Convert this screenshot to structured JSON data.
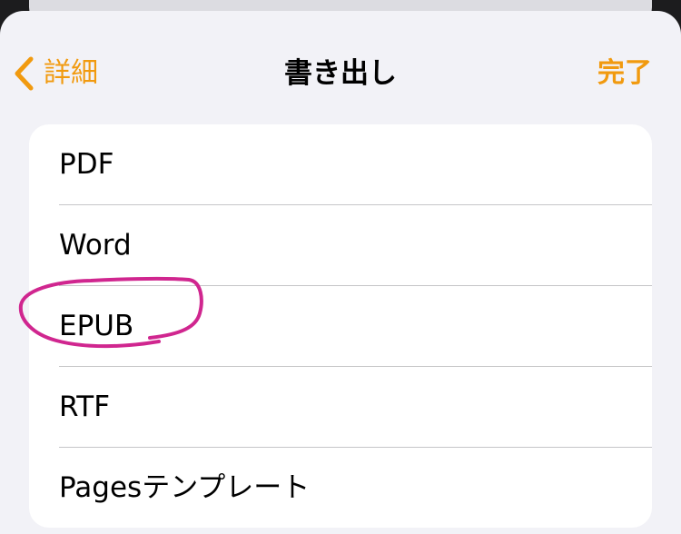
{
  "nav": {
    "back_label": "詳細",
    "title": "書き出し",
    "done_label": "完了"
  },
  "export_options": [
    {
      "label": "PDF"
    },
    {
      "label": "Word"
    },
    {
      "label": "EPUB"
    },
    {
      "label": "RTF"
    },
    {
      "label": "Pagesテンプレート"
    }
  ],
  "colors": {
    "accent": "#f19a0f",
    "annotation": "#d0268f",
    "sheet_background": "#f2f2f7",
    "list_background": "#ffffff"
  }
}
